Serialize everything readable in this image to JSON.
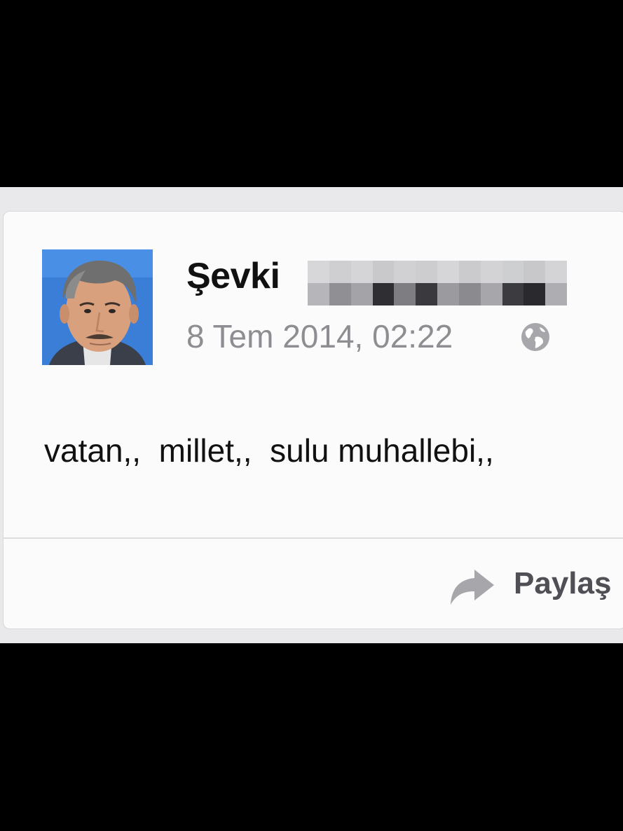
{
  "post": {
    "author_name": "Şevki",
    "timestamp": "8 Tem 2014, 02:22",
    "body": "vatan,,  millet,,  sulu muhallebi,,",
    "privacy_icon": "globe-icon"
  },
  "actions": {
    "share_label": "Paylaş",
    "share_icon": "share-arrow-icon"
  },
  "colors": {
    "screen_background": "#000000",
    "card_background": "#fbfbfb",
    "name_text": "#111111",
    "meta_text": "#8d8d92",
    "share_text": "#4f4f55"
  }
}
